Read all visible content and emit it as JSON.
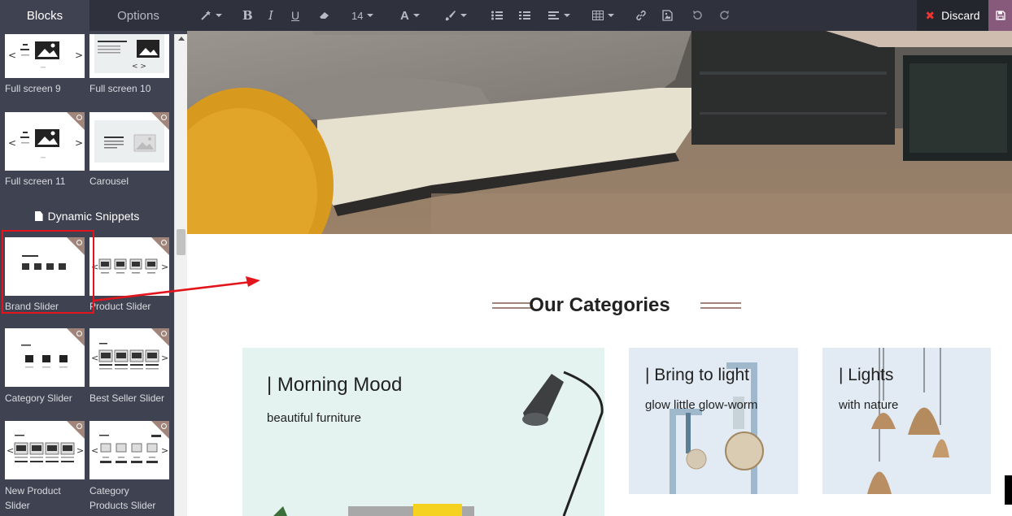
{
  "sidebar": {
    "tabs": [
      {
        "label": "Blocks",
        "active": true
      },
      {
        "label": "Options",
        "active": false
      }
    ],
    "section_dynamic": "Dynamic Snippets",
    "blocks": [
      {
        "label": "Full screen 9",
        "premium": false
      },
      {
        "label": "Full screen 10",
        "premium": false
      },
      {
        "label": "Full screen 11",
        "premium": true
      },
      {
        "label": "Carousel",
        "premium": true
      },
      {
        "label": "Brand Slider",
        "premium": true,
        "selected": true
      },
      {
        "label": "Product Slider",
        "premium": true
      },
      {
        "label": "Category Slider",
        "premium": true
      },
      {
        "label": "Best Seller Slider",
        "premium": true
      },
      {
        "label": "New Product Slider",
        "premium": true
      },
      {
        "label": "Category Products Slider",
        "premium": true
      }
    ]
  },
  "toolbar": {
    "font_size": "14",
    "discard_label": "Discard",
    "icons": [
      "magic-wand-icon",
      "bold-icon",
      "italic-icon",
      "underline-icon",
      "eraser-icon",
      "font-size-dropdown",
      "font-color-icon",
      "paint-brush-icon",
      "unordered-list-icon",
      "ordered-list-icon",
      "align-icon",
      "table-icon",
      "link-icon",
      "image-icon",
      "undo-icon",
      "redo-icon",
      "save-icon"
    ]
  },
  "canvas": {
    "categories_heading": "Our Categories",
    "cards": [
      {
        "title": "| Morning Mood",
        "subtitle": "beautiful furniture"
      },
      {
        "title": "| Bring to light",
        "subtitle": "glow little glow-worm"
      },
      {
        "title": "| Lights",
        "subtitle": "with nature"
      }
    ]
  },
  "colors": {
    "sidebar_bg": "#3f4250",
    "toolbar_bg": "#2f323d",
    "accent_brown": "#a1857a",
    "save_purple": "#875a7b",
    "highlight_red": "#e3141b",
    "card_mint": "#e4f3ef",
    "card_blue": "#e2ebf3"
  }
}
